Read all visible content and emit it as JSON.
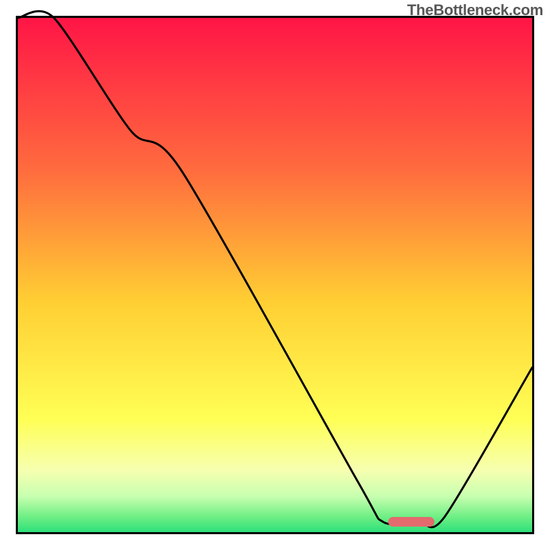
{
  "watermark": "TheBottleneck.com",
  "chart_data": {
    "type": "line",
    "title": "",
    "xlabel": "",
    "ylabel": "",
    "xlim": [
      0,
      100
    ],
    "ylim": [
      0,
      100
    ],
    "series": [
      {
        "name": "bottleneck-curve",
        "x": [
          0,
          7,
          22,
          32,
          66,
          71,
          78,
          83,
          100
        ],
        "y": [
          100,
          100,
          78,
          70,
          10,
          2,
          2,
          3,
          32
        ]
      }
    ],
    "marker": {
      "name": "optimal-segment",
      "x_start": 72,
      "x_end": 81,
      "y": 2,
      "color": "#e46a6e"
    },
    "gradient_stops": [
      {
        "offset": 0,
        "color": "#ff1546"
      },
      {
        "offset": 30,
        "color": "#ff6d3e"
      },
      {
        "offset": 55,
        "color": "#ffce33"
      },
      {
        "offset": 78,
        "color": "#ffff55"
      },
      {
        "offset": 88,
        "color": "#f6ffb0"
      },
      {
        "offset": 93,
        "color": "#c8ffb0"
      },
      {
        "offset": 97,
        "color": "#6fef85"
      },
      {
        "offset": 100,
        "color": "#2de07a"
      }
    ],
    "frame": {
      "stroke": "#000000",
      "stroke_width": 3
    }
  }
}
